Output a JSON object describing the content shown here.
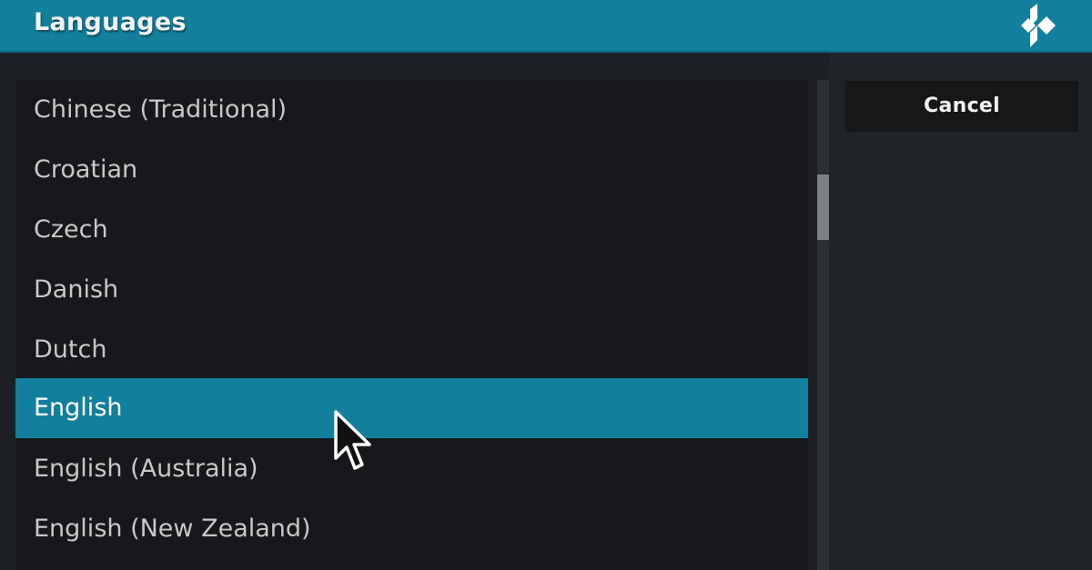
{
  "header": {
    "title": "Languages",
    "logo_icon": "kodi-logo-icon"
  },
  "list": {
    "items": [
      {
        "label": "Chinese (Traditional)",
        "selected": false
      },
      {
        "label": "Croatian",
        "selected": false
      },
      {
        "label": "Czech",
        "selected": false
      },
      {
        "label": "Danish",
        "selected": false
      },
      {
        "label": "Dutch",
        "selected": false
      },
      {
        "label": "English",
        "selected": true
      },
      {
        "label": "English (Australia)",
        "selected": false
      },
      {
        "label": "English (New Zealand)",
        "selected": false
      }
    ]
  },
  "side": {
    "cancel_label": "Cancel"
  },
  "colors": {
    "accent": "#12809c",
    "background": "#1c2024",
    "list_background": "#16181b",
    "text": "#c8c8c8",
    "selected_text": "#ffffff"
  }
}
